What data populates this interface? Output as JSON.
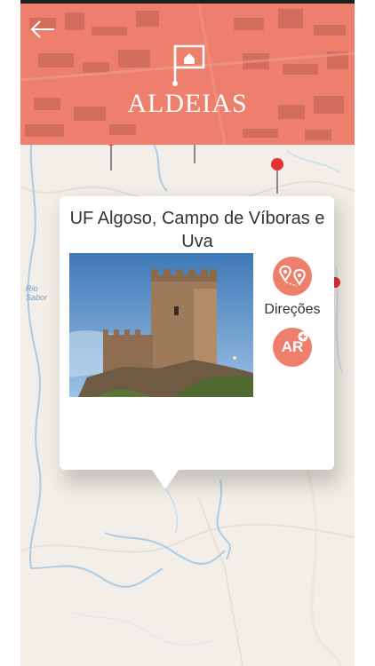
{
  "header": {
    "title": "ALDEIAS",
    "back_icon": "arrow-left-icon",
    "logo_icon": "village-flag-icon",
    "color": "#ee7f6c"
  },
  "map": {
    "river_label_line1": "Rio",
    "river_label_line2": "Sabor",
    "pin_color": "#e8322f"
  },
  "popup": {
    "title": "UF Algoso, Campo de Víboras e Uva",
    "photo_alt": "Castelo de Algoso",
    "directions_label": "Direções",
    "directions_icon": "directions-pins-icon",
    "ar_label": "AR",
    "ar_icon": "ar-plus-icon"
  }
}
